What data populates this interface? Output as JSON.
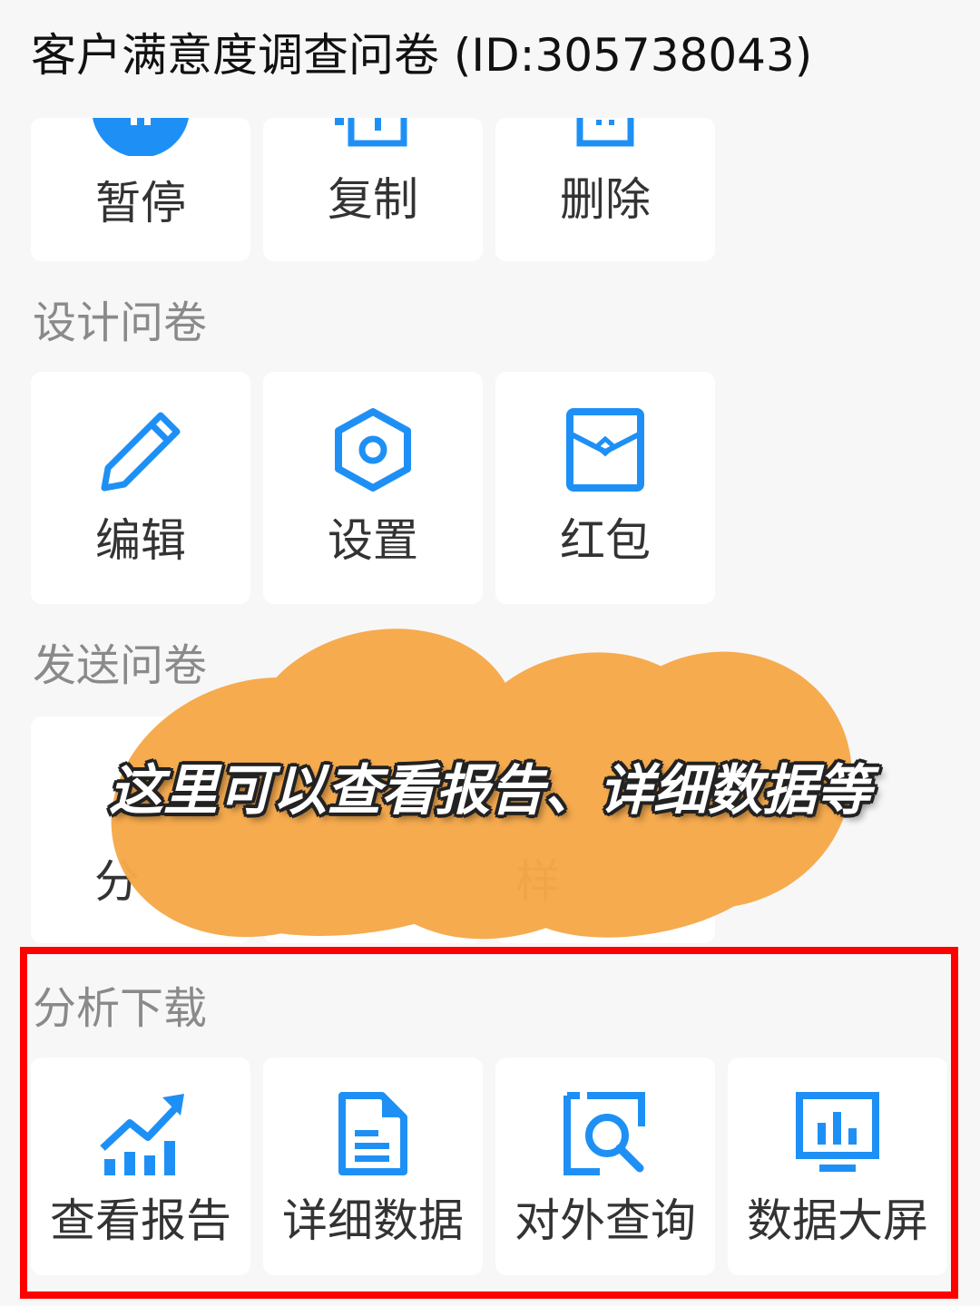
{
  "header": {
    "title": "客户满意度调查问卷 (ID:305738043)"
  },
  "colors": {
    "accent": "#1e90f5",
    "highlight": "#ff0000",
    "overlay": "#f6a94a"
  },
  "top_actions": [
    {
      "label": "暂停",
      "icon": "pause-circle-icon"
    },
    {
      "label": "复制",
      "icon": "copy-icon"
    },
    {
      "label": "删除",
      "icon": "trash-icon"
    }
  ],
  "design_section": {
    "title": "设计问卷",
    "items": [
      {
        "label": "编辑",
        "icon": "pencil-icon"
      },
      {
        "label": "设置",
        "icon": "hexagon-settings-icon"
      },
      {
        "label": "红包",
        "icon": "red-envelope-icon"
      }
    ]
  },
  "send_section": {
    "title": "发送问卷",
    "visible_fragments": [
      "分",
      "样"
    ]
  },
  "overlay": {
    "caption": "这里可以查看报告、详细数据等"
  },
  "analysis_section": {
    "title": "分析下载",
    "items": [
      {
        "label": "查看报告",
        "icon": "trending-chart-icon"
      },
      {
        "label": "详细数据",
        "icon": "document-icon"
      },
      {
        "label": "对外查询",
        "icon": "search-frame-icon"
      },
      {
        "label": "数据大屏",
        "icon": "monitor-chart-icon"
      }
    ]
  }
}
